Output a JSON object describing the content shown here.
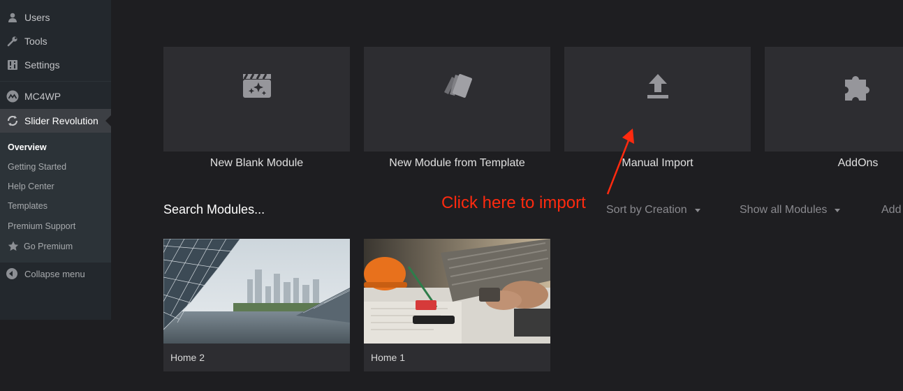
{
  "sidebar": {
    "items": [
      {
        "label": "Users",
        "icon": "users-icon"
      },
      {
        "label": "Tools",
        "icon": "wrench-icon"
      },
      {
        "label": "Settings",
        "icon": "settings-icon"
      },
      {
        "label": "MC4WP",
        "icon": "mc4wp-icon"
      },
      {
        "label": "Slider Revolution",
        "icon": "refresh-icon"
      }
    ],
    "submenu": [
      {
        "label": "Overview"
      },
      {
        "label": "Getting Started"
      },
      {
        "label": "Help Center"
      },
      {
        "label": "Templates"
      },
      {
        "label": "Premium Support"
      },
      {
        "label": "Go Premium",
        "icon": "star-icon"
      }
    ],
    "collapse_label": "Collapse menu"
  },
  "actions": [
    {
      "label": "New Blank Module",
      "icon": "clapperboard-sparkle-icon"
    },
    {
      "label": "New Module from Template",
      "icon": "template-cards-icon"
    },
    {
      "label": "Manual Import",
      "icon": "upload-icon"
    },
    {
      "label": "AddOns",
      "icon": "puzzle-icon"
    }
  ],
  "toolbar": {
    "search_label": "Search Modules...",
    "sort_label": "Sort by Creation",
    "filter_label": "Show all Modules",
    "add_label": "Add"
  },
  "annotation": {
    "text": "Click here to import",
    "color": "#ff2a0f"
  },
  "modules": [
    {
      "label": "Home 2",
      "thumbnail": "architecture-cityscape"
    },
    {
      "label": "Home 1",
      "thumbnail": "construction-plans"
    }
  ],
  "colors": {
    "background": "#1e1e21",
    "card": "#2d2d31",
    "sidebar": "#23282d",
    "accent": "#ff2a0f"
  }
}
